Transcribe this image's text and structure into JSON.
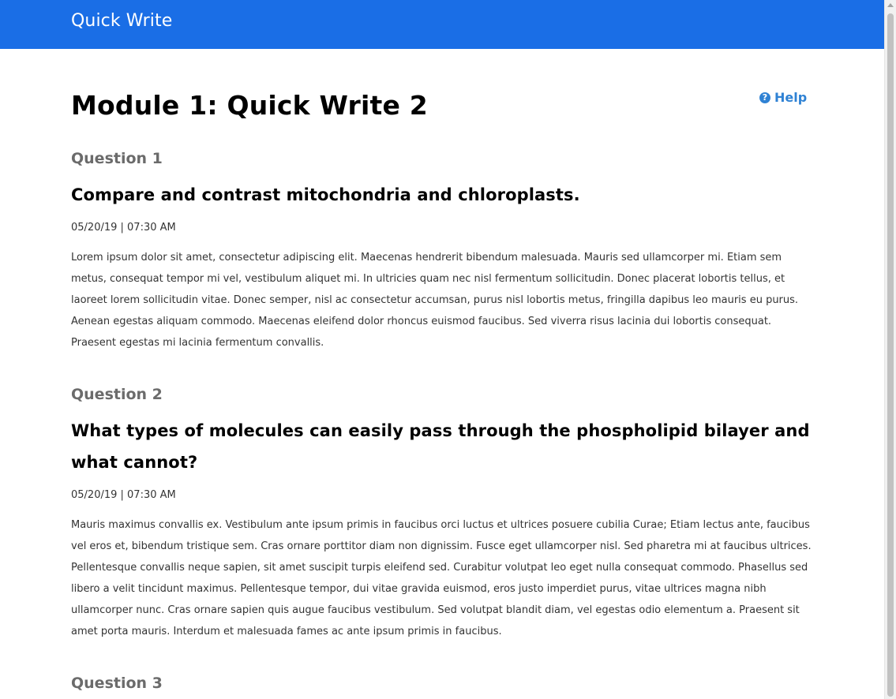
{
  "header": {
    "brand": "Quick Write"
  },
  "page": {
    "title": "Module 1: Quick Write 2",
    "help_label": "Help",
    "help_icon": "question-circle-icon"
  },
  "questions": [
    {
      "label": "Question 1",
      "prompt": "Compare and contrast mitochondria and chloroplasts.",
      "timestamp": "05/20/19 | 07:30 AM",
      "answer": "Lorem ipsum dolor sit amet, consectetur adipiscing elit. Maecenas hendrerit bibendum malesuada. Mauris sed ullamcorper mi. Etiam sem metus, consequat tempor mi vel, vestibulum aliquet mi. In ultricies quam nec nisl fermentum sollicitudin. Donec placerat lobortis tellus, et laoreet lorem sollicitudin vitae. Donec semper, nisl ac consectetur accumsan, purus nisl lobortis metus, fringilla dapibus leo mauris eu purus. Aenean egestas aliquam commodo. Maecenas eleifend dolor rhoncus euismod faucibus. Sed viverra risus lacinia dui lobortis consequat. Praesent egestas mi lacinia fermentum convallis."
    },
    {
      "label": "Question 2",
      "prompt": "What types of molecules can easily pass through the phospholipid bilayer and what cannot?",
      "timestamp": "05/20/19 | 07:30 AM",
      "answer": "Mauris maximus convallis ex. Vestibulum ante ipsum primis in faucibus orci luctus et ultrices posuere cubilia Curae; Etiam lectus ante, faucibus vel eros et, bibendum tristique sem. Cras ornare porttitor diam non dignissim. Fusce eget ullamcorper nisl. Sed pharetra mi at faucibus ultrices. Pellentesque convallis neque sapien, sit amet suscipit turpis eleifend sed. Curabitur volutpat leo eget nulla consequat commodo. Phasellus sed libero a velit tincidunt maximus. Pellentesque tempor, dui vitae gravida euismod, eros justo imperdiet purus, vitae ultrices magna nibh ullamcorper nunc. Cras ornare sapien quis augue faucibus vestibulum. Sed volutpat blandit diam, vel egestas odio elementum a. Praesent sit amet porta mauris. Interdum et malesuada fames ac ante ipsum primis in faucibus."
    },
    {
      "label": "Question 3"
    }
  ],
  "colors": {
    "header_bg": "#1a6ee6",
    "link": "#2f82d4",
    "question_label": "#6b6b6b"
  }
}
